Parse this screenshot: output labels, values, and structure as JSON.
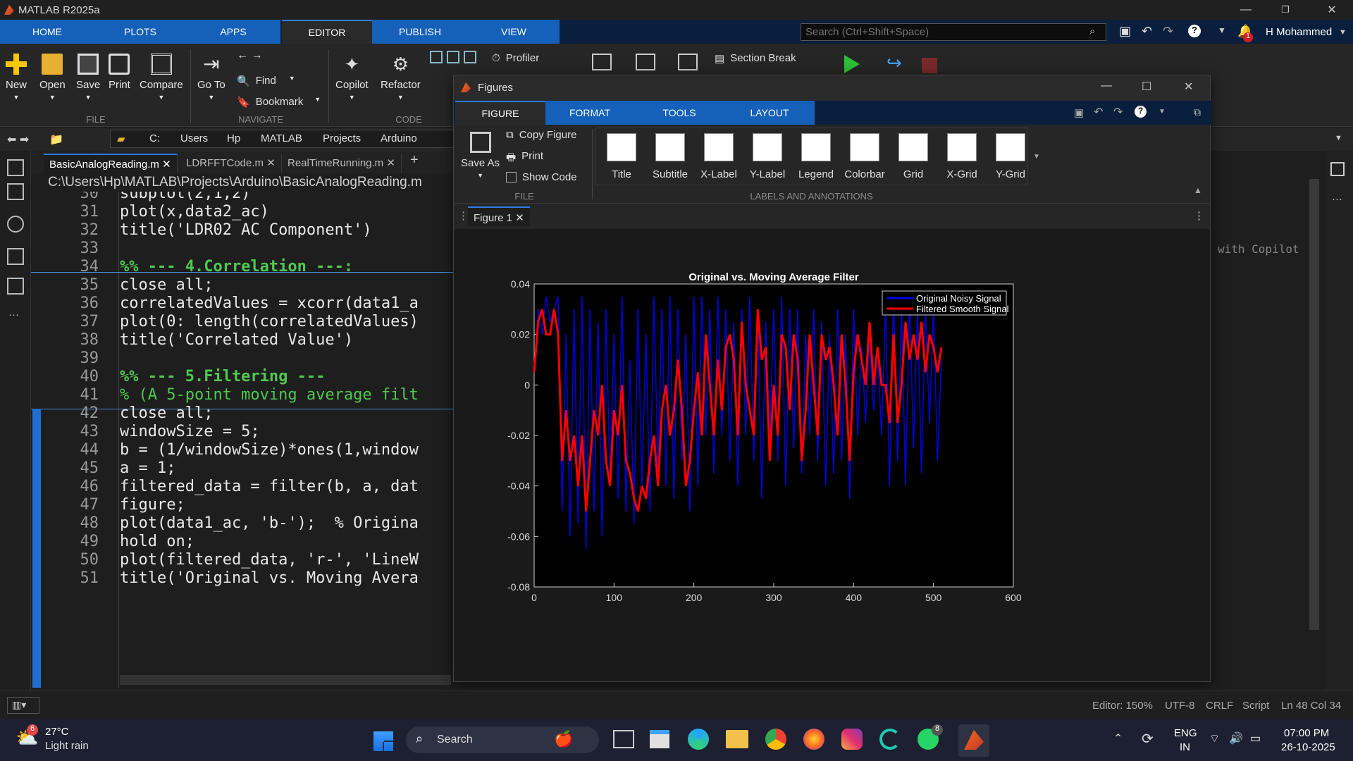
{
  "window": {
    "title": "MATLAB R2025a",
    "min": "—",
    "max": "❐",
    "close": "✕"
  },
  "ribbon_tabs": [
    "HOME",
    "PLOTS",
    "APPS",
    "EDITOR",
    "PUBLISH",
    "VIEW"
  ],
  "search": {
    "placeholder": "Search (Ctrl+Shift+Space)"
  },
  "user": {
    "name": "H Mohammed",
    "notif_count": "1"
  },
  "toolbar": {
    "new": "New",
    "open": "Open",
    "save": "Save",
    "print": "Print",
    "compare": "Compare",
    "goto": "Go To",
    "find": "Find",
    "bookmark": "Bookmark",
    "copilot": "Copilot",
    "refactor": "Refactor",
    "profiler": "Profiler",
    "section_break": "Section Break",
    "sec_file": "FILE",
    "sec_navigate": "NAVIGATE",
    "sec_code": "CODE"
  },
  "breadcrumb": [
    "C:",
    "Users",
    "Hp",
    "MATLAB",
    "Projects",
    "Arduino"
  ],
  "editor_tabs": [
    "BasicAnalogReading.m",
    "LDRFFTCode.m",
    "RealTimeRunning.m"
  ],
  "editor_path": "C:\\Users\\Hp\\MATLAB\\Projects\\Arduino\\BasicAnalogReading.m",
  "code_lines": [
    {
      "n": "30",
      "t": "subplot(2,1,2)"
    },
    {
      "n": "31",
      "t": "plot(x,data2_ac)"
    },
    {
      "n": "32",
      "t": "title('LDR02 AC Component')"
    },
    {
      "n": "33",
      "t": ""
    },
    {
      "n": "34",
      "t": "%% --- 4.Correlation ---:"
    },
    {
      "n": "35",
      "t": "close all;"
    },
    {
      "n": "36",
      "t": "correlatedValues = xcorr(data1_a"
    },
    {
      "n": "37",
      "t": "plot(0: length(correlatedValues)"
    },
    {
      "n": "38",
      "t": "title('Correlated Value')"
    },
    {
      "n": "39",
      "t": ""
    },
    {
      "n": "40",
      "t": "%% --- 5.Filtering ---"
    },
    {
      "n": "41",
      "t": "% (A 5-point moving average filt"
    },
    {
      "n": "42",
      "t": "close all;"
    },
    {
      "n": "43",
      "t": "windowSize = 5;"
    },
    {
      "n": "44",
      "t": "b = (1/windowSize)*ones(1,window"
    },
    {
      "n": "45",
      "t": "a = 1;"
    },
    {
      "n": "46",
      "t": "filtered_data = filter(b, a, dat"
    },
    {
      "n": "47",
      "t": "figure;"
    },
    {
      "n": "48",
      "t": "plot(data1_ac, 'b-');  % Origina"
    },
    {
      "n": "49",
      "t": "hold on;"
    },
    {
      "n": "50",
      "t": "plot(filtered_data, 'r-', 'LineW"
    },
    {
      "n": "51",
      "t": "title('Original vs. Moving Avera"
    }
  ],
  "right_hint": "with Copilot",
  "figures": {
    "title": "Figures",
    "tabs": [
      "FIGURE",
      "FORMAT",
      "TOOLS",
      "LAYOUT"
    ],
    "save_as": "Save As",
    "copy_figure": "Copy Figure",
    "print": "Print",
    "show_code": "Show Code",
    "sec_file": "FILE",
    "sec_labels": "LABELS AND ANNOTATIONS",
    "gallery": [
      "Title",
      "Subtitle",
      "X-Label",
      "Y-Label",
      "Legend",
      "Colorbar",
      "Grid",
      "X-Grid",
      "Y-Grid"
    ],
    "doc_tab": "Figure 1"
  },
  "chart_data": {
    "type": "line",
    "title": "Original vs. Moving Average Filter",
    "xlim": [
      0,
      600
    ],
    "ylim": [
      -0.08,
      0.04
    ],
    "xticks": [
      "0",
      "100",
      "200",
      "300",
      "400",
      "500",
      "600"
    ],
    "yticks": [
      "0.04",
      "0.02",
      "0",
      "-0.02",
      "-0.04",
      "-0.06",
      "-0.08"
    ],
    "legend_position": "top-right",
    "series": [
      {
        "name": "Original Noisy Signal",
        "color": "#0000e6",
        "x": [
          0,
          5,
          10,
          15,
          20,
          25,
          30,
          35,
          40,
          45,
          50,
          55,
          60,
          65,
          70,
          75,
          80,
          85,
          90,
          95,
          100,
          105,
          110,
          115,
          120,
          125,
          130,
          135,
          140,
          145,
          150,
          155,
          160,
          165,
          170,
          175,
          180,
          185,
          190,
          195,
          200,
          205,
          210,
          215,
          220,
          225,
          230,
          235,
          240,
          245,
          250,
          255,
          260,
          265,
          270,
          275,
          280,
          285,
          290,
          295,
          300,
          305,
          310,
          315,
          320,
          325,
          330,
          335,
          340,
          345,
          350,
          355,
          360,
          365,
          370,
          375,
          380,
          385,
          390,
          395,
          400,
          405,
          410,
          415,
          420,
          425,
          430,
          435,
          440,
          445,
          450,
          455,
          460,
          465,
          470,
          475,
          480,
          485,
          490,
          495,
          500,
          505,
          510
        ],
        "y": [
          0.005,
          0.03,
          0.02,
          0.035,
          0.025,
          0.03,
          0.035,
          -0.05,
          0.02,
          -0.06,
          0.03,
          -0.055,
          0.035,
          -0.065,
          0.03,
          -0.05,
          0.025,
          -0.06,
          0.03,
          -0.04,
          0.02,
          -0.045,
          0.035,
          -0.05,
          0.01,
          -0.055,
          0.03,
          -0.04,
          0.02,
          -0.05,
          0.035,
          -0.035,
          0.03,
          -0.04,
          0.035,
          -0.045,
          0.03,
          -0.03,
          0.02,
          -0.05,
          0.035,
          -0.04,
          0.035,
          -0.02,
          0.03,
          -0.035,
          0.035,
          -0.02,
          0.03,
          -0.03,
          0.025,
          -0.04,
          0.03,
          -0.02,
          0.035,
          -0.03,
          0.03,
          -0.045,
          0.025,
          -0.02,
          0.03,
          -0.03,
          0.035,
          -0.04,
          0.03,
          -0.025,
          0.03,
          -0.035,
          0.02,
          -0.02,
          0.03,
          -0.03,
          0.025,
          -0.04,
          0.02,
          -0.035,
          0.03,
          -0.03,
          0.02,
          -0.045,
          0.03,
          -0.02,
          0.015,
          -0.015,
          0.02,
          -0.01,
          0.015,
          -0.02,
          0.03,
          -0.04,
          0.035,
          -0.03,
          0.03,
          -0.04,
          0.035,
          -0.025,
          0.03,
          -0.035,
          0.03,
          -0.015,
          0.03,
          -0.03,
          0.01
        ]
      },
      {
        "name": "Filtered Smooth Signal",
        "color": "#ff0000",
        "x": [
          0,
          5,
          10,
          15,
          20,
          25,
          30,
          35,
          40,
          45,
          50,
          55,
          60,
          65,
          70,
          75,
          80,
          85,
          90,
          95,
          100,
          105,
          110,
          115,
          120,
          125,
          130,
          135,
          140,
          145,
          150,
          155,
          160,
          165,
          170,
          175,
          180,
          185,
          190,
          195,
          200,
          205,
          210,
          215,
          220,
          225,
          230,
          235,
          240,
          245,
          250,
          255,
          260,
          265,
          270,
          275,
          280,
          285,
          290,
          295,
          300,
          305,
          310,
          315,
          320,
          325,
          330,
          335,
          340,
          345,
          350,
          355,
          360,
          365,
          370,
          375,
          380,
          385,
          390,
          395,
          400,
          405,
          410,
          415,
          420,
          425,
          430,
          435,
          440,
          445,
          450,
          455,
          460,
          465,
          470,
          475,
          480,
          485,
          490,
          495,
          500,
          505,
          510
        ],
        "y": [
          0.005,
          0.025,
          0.03,
          0.02,
          0.02,
          0.03,
          0.02,
          -0.03,
          -0.01,
          -0.03,
          -0.02,
          -0.04,
          -0.02,
          -0.05,
          -0.03,
          -0.01,
          -0.02,
          0.0,
          -0.03,
          -0.04,
          -0.01,
          -0.02,
          0.0,
          -0.03,
          -0.035,
          -0.045,
          -0.05,
          -0.04,
          -0.045,
          -0.03,
          -0.02,
          -0.04,
          -0.01,
          0.0,
          -0.02,
          -0.01,
          0.01,
          -0.01,
          -0.04,
          -0.03,
          -0.01,
          0.005,
          -0.02,
          0.02,
          0.0,
          -0.02,
          0.01,
          -0.01,
          0.015,
          0.02,
          0.01,
          -0.02,
          0.025,
          0.0,
          -0.01,
          -0.02,
          0.03,
          0.01,
          0.015,
          -0.03,
          0.0,
          -0.02,
          0.02,
          0.015,
          -0.01,
          0.02,
          0.01,
          -0.03,
          -0.01,
          0.02,
          0.0,
          -0.02,
          0.02,
          0.01,
          0.015,
          0.0,
          -0.02,
          0.02,
          0.0,
          -0.03,
          0.005,
          0.02,
          0.01,
          0.0,
          0.025,
          0.0,
          0.015,
          0.0,
          0.0,
          -0.015,
          0.02,
          -0.015,
          0.0,
          0.025,
          0.01,
          0.02,
          0.01,
          0.025,
          0.005,
          0.02,
          0.015,
          0.005,
          0.015
        ]
      }
    ]
  },
  "status": {
    "zoom": "Editor: 150%",
    "encoding": "UTF-8",
    "eol": "CRLF",
    "type": "Script",
    "pos": "Ln 48 Col 34"
  },
  "taskbar": {
    "temp": "27°C",
    "weather": "Light rain",
    "weather_badge": "6",
    "search": "Search",
    "lang1": "ENG",
    "lang2": "IN",
    "time": "07:00 PM",
    "date": "26-10-2025",
    "wa_badge": "8"
  }
}
